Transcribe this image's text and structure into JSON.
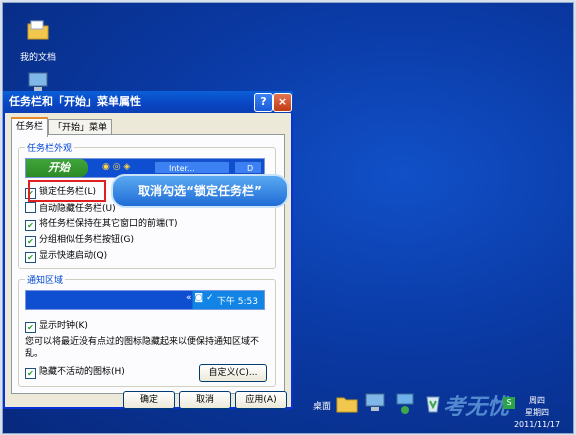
{
  "desktop": {
    "icons": [
      {
        "label": "我的文档",
        "icon": "folder-icon"
      },
      {
        "label": "",
        "icon": "computer-icon"
      }
    ]
  },
  "dialog": {
    "title": "任务栏和「开始」菜单属性",
    "help_glyph": "?",
    "close_glyph": "×",
    "tabs": [
      "任务栏",
      "「开始」菜单"
    ],
    "appearance": {
      "legend": "任务栏外观",
      "start_button": "开始",
      "task_item": "Inter...",
      "folder_item": "D",
      "options": [
        {
          "label": "锁定任务栏(L)",
          "checked": true
        },
        {
          "label": "自动隐藏任务栏(U)",
          "checked": false
        },
        {
          "label": "将任务栏保持在其它窗口的前端(T)",
          "checked": true
        },
        {
          "label": "分组相似任务栏按钮(G)",
          "checked": true
        },
        {
          "label": "显示快速启动(Q)",
          "checked": true
        }
      ]
    },
    "notification": {
      "legend": "通知区域",
      "preview_time": "下午 5:53",
      "show_clock": {
        "label": "显示时钟(K)",
        "checked": true
      },
      "description": "您可以将最近没有点过的图标隐藏起来以便保持通知区域不乱。",
      "hide_inactive": {
        "label": "隐藏不活动的图标(H)",
        "checked": true
      },
      "customize_button": "自定义(C)..."
    },
    "buttons": {
      "ok": "确定",
      "cancel": "取消",
      "apply": "应用(A)"
    }
  },
  "annotation": {
    "callout_text": "取消勾选“锁定任务栏”",
    "highlight_color": "#e02020"
  },
  "taskbar": {
    "desktop_label": "桌面",
    "clock_time": "周四",
    "clock_day": "星期四",
    "clock_date": "2011/11/17",
    "watermark": "考无忧"
  },
  "colors": {
    "accent": "#0a45c2",
    "desktop": "#0a3596",
    "callout": "#1f6cd6"
  }
}
